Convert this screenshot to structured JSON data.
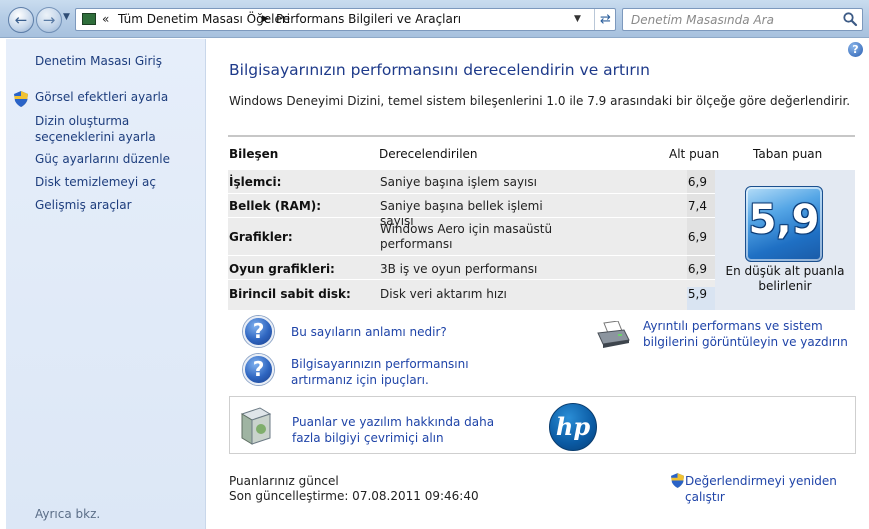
{
  "address_bar": {
    "breadcrumb_chevron": "«",
    "crumb1": "Tüm Denetim Masası Öğeleri",
    "crumb_sep": "▶",
    "crumb2": "Performans Bilgileri ve Araçları",
    "search_placeholder": "Denetim Masasında Ara"
  },
  "sidebar": {
    "items": [
      {
        "label": "Denetim Masası Giriş"
      },
      {
        "label": "Görsel efektleri ayarla",
        "icon": "uac-shield-icon"
      },
      {
        "label": "Dizin oluşturma seçeneklerini ayarla"
      },
      {
        "label": "Güç ayarlarını düzenle"
      },
      {
        "label": "Disk temizlemeyi aç"
      },
      {
        "label": "Gelişmiş araçlar"
      }
    ],
    "see_also": "Ayrıca bkz."
  },
  "main": {
    "help": "?",
    "title": "Bilgisayarınızın performansını derecelendirin ve artırın",
    "description": "Windows Deneyimi Dizini, temel sistem bileşenlerini 1.0 ile 7.9 arasındaki bir ölçeğe göre değerlendirir.",
    "table": {
      "headers": {
        "component": "Bileşen",
        "rated": "Derecelendirilen",
        "subscore": "Alt puan",
        "basescore": "Taban puan"
      },
      "rows": [
        {
          "component": "İşlemci:",
          "rated": "Saniye başına işlem sayısı",
          "score": "6,9"
        },
        {
          "component": "Bellek (RAM):",
          "rated": "Saniye başına bellek işlemi sayısı",
          "score": "7,4"
        },
        {
          "component": "Grafikler:",
          "rated": "Windows Aero için masaüstü performansı",
          "score": "6,9"
        },
        {
          "component": "Oyun grafikleri:",
          "rated": "3B iş ve oyun performansı",
          "score": "6,9"
        },
        {
          "component": "Birincil sabit disk:",
          "rated": "Disk veri aktarım hızı",
          "score": "5,9"
        }
      ],
      "base_score": "5,9",
      "base_caption": "En düşük alt puanla belirlenir"
    },
    "links": {
      "meaning": "Bu sayıların anlamı nedir?",
      "tips": "Bilgisayarınızın performansını artırmanız için ipuçları.",
      "details": "Ayrıntılı performans ve sistem bilgilerini görüntüleyin ve yazdırın",
      "online": "Puanlar ve yazılım hakkında daha fazla bilgiyi çevrimiçi alın",
      "rerun": "Değerlendirmeyi yeniden çalıştır"
    },
    "hp_logo": "hp",
    "status": {
      "current": "Puanlarınız güncel",
      "last_update": "Son güncelleştirme: 07.08.2011 09:46:40"
    }
  },
  "colors": {
    "link": "#1f44a8",
    "title": "#1e3a8a",
    "sidebar_bg": "#e6eefa"
  }
}
